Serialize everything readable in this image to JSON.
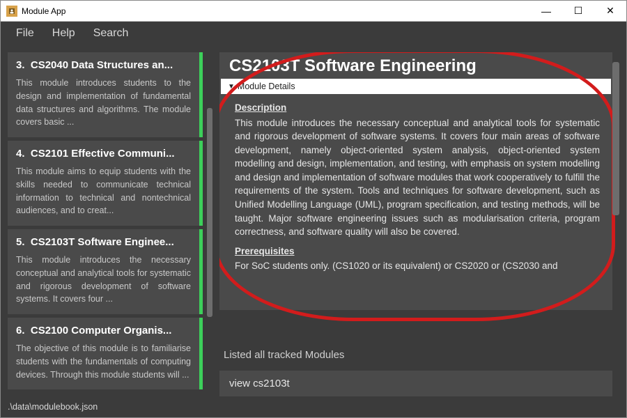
{
  "window": {
    "title": "Module App",
    "min": "—",
    "max": "☐",
    "close": "✕"
  },
  "menubar": {
    "items": [
      "File",
      "Help",
      "Search"
    ]
  },
  "sidebar": {
    "items": [
      {
        "idx": "3.",
        "title": "CS2040 Data Structures an...",
        "desc": "This module introduces students to the design and implementation of fundamental data structures and algorithms. The module covers basic ..."
      },
      {
        "idx": "4.",
        "title": "CS2101 Effective Communi...",
        "desc": "This module aims to equip students with the skills needed to communicate technical information to technical and nontechnical audiences, and to creat..."
      },
      {
        "idx": "5.",
        "title": "CS2103T Software Enginee...",
        "desc": "This module introduces the necessary conceptual and analytical tools for systematic and rigorous development of software systems. It covers four ..."
      },
      {
        "idx": "6.",
        "title": "CS2100 Computer Organis...",
        "desc": "The objective of this module is to familiarise students with the fundamentals of computing devices. Through this module students will ..."
      }
    ]
  },
  "detail": {
    "title": "CS2103T Software Engineering",
    "header": "Module Details",
    "desc_label": "Description",
    "desc_text": "This module introduces the necessary conceptual and analytical tools for systematic and rigorous development of software systems. It covers four main areas of software development, namely object-oriented system analysis, object-oriented system modelling and design, implementation, and testing, with emphasis on system modelling and design and implementation of software modules that work cooperatively to fulfill the requirements of the system. Tools and techniques for software development, such as Unified Modelling Language (UML), program specification, and testing methods, will be taught. Major software engineering issues such as modularisation criteria, program correctness, and software quality will also be covered.",
    "prereq_label": "Prerequisites",
    "prereq_text": "For SoC students only. (CS1020 or its equivalent) or CS2020 or (CS2030 and"
  },
  "status": "Listed all tracked Modules",
  "command": "view cs2103t",
  "footer": ".\\data\\modulebook.json",
  "disclosure": "▼"
}
